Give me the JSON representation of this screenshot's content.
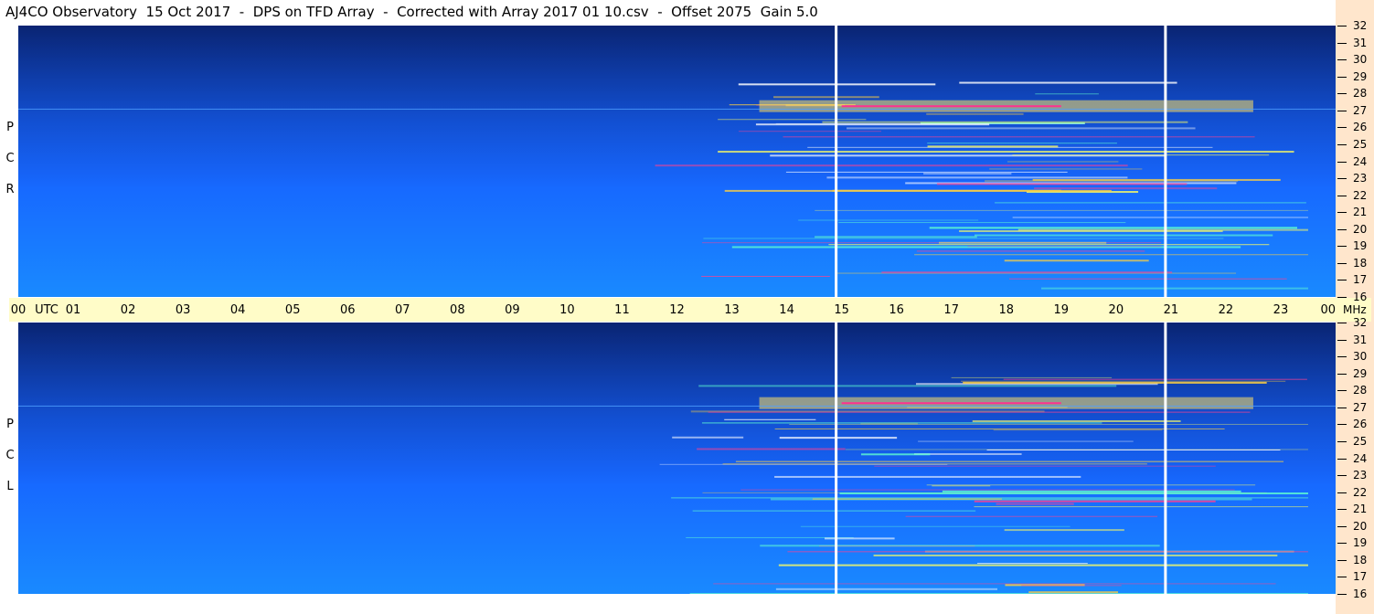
{
  "header": {
    "title": "AJ4CO Observatory  15 Oct 2017  -  DPS on TFD Array  -  Corrected with Array 2017 01 10.csv  -  Offset 2075  Gain 5.0"
  },
  "panels": {
    "top_letters": [
      "R",
      "C",
      "P"
    ],
    "bottom_letters": [
      "L",
      "C",
      "P"
    ]
  },
  "chart_data": {
    "type": "heatmap",
    "title": "AJ4CO Observatory  15 Oct 2017  -  DPS on TFD Array  -  Corrected with Array 2017 01 10.csv  -  Offset 2075  Gain 5.0",
    "x_ticks": [
      "00",
      "01",
      "02",
      "03",
      "04",
      "05",
      "06",
      "07",
      "08",
      "09",
      "10",
      "11",
      "12",
      "13",
      "14",
      "15",
      "16",
      "17",
      "18",
      "19",
      "20",
      "21",
      "22",
      "23",
      "00"
    ],
    "x_unit": "UTC",
    "xlim": [
      0,
      24
    ],
    "y_ticks": [
      16,
      17,
      18,
      19,
      20,
      21,
      22,
      23,
      24,
      25,
      26,
      27,
      28,
      29,
      30,
      31,
      32
    ],
    "y_unit": "MHz",
    "ylim": [
      16,
      32
    ],
    "colors": {
      "low": "#000015",
      "mid": "#1550ff",
      "high": "#ffff40",
      "peak": "#ff2080"
    },
    "series": [
      {
        "name": "R C P",
        "bright_region_hours": [
          11.5,
          23.5
        ],
        "vertical_markers_hours": [
          14.9,
          20.9
        ]
      },
      {
        "name": "L C P",
        "bright_region_hours": [
          11.5,
          23.5
        ],
        "vertical_markers_hours": [
          14.9,
          20.9
        ]
      }
    ]
  }
}
